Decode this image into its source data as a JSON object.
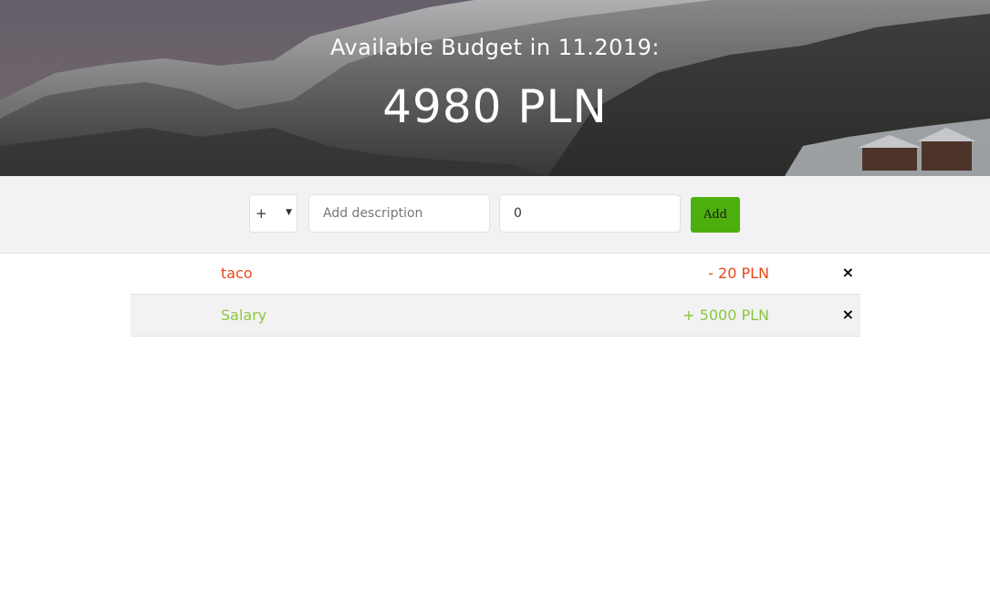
{
  "header": {
    "title": "Available Budget in 11.2019:",
    "budget": "4980 PLN"
  },
  "add_form": {
    "type_selected": "+",
    "description_placeholder": "Add description",
    "value": "0",
    "add_label": "Add"
  },
  "entries": [
    {
      "description": "taco",
      "amount": "- 20 PLN",
      "type": "expense",
      "delete_icon": "×"
    },
    {
      "description": "Salary",
      "amount": "+ 5000 PLN",
      "type": "income",
      "delete_icon": "×"
    }
  ],
  "colors": {
    "expense": "#e8471d",
    "income": "#8dc63f",
    "add_button": "#4caf0d"
  }
}
